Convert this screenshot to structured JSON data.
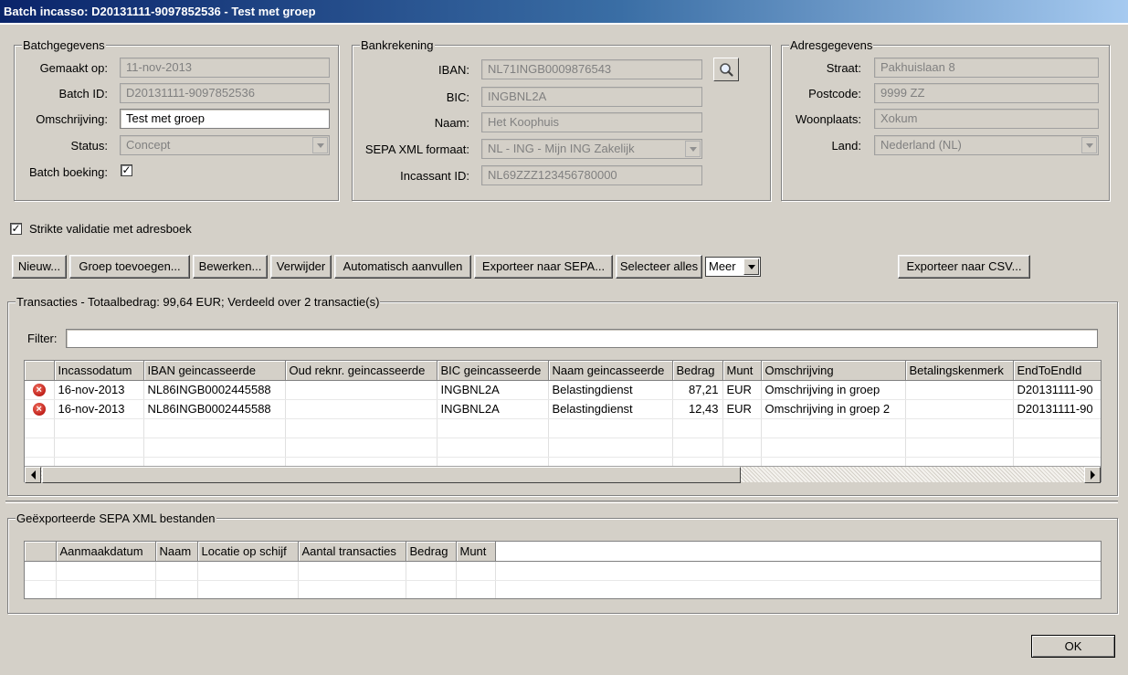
{
  "window": {
    "title": "Batch incasso: D20131111-9097852536 - Test met groep"
  },
  "batch": {
    "legend": "Batchgegevens",
    "created_label": "Gemaakt op:",
    "created_value": "11-nov-2013",
    "id_label": "Batch ID:",
    "id_value": "D20131111-9097852536",
    "desc_label": "Omschrijving:",
    "desc_value": "Test met groep",
    "status_label": "Status:",
    "status_value": "Concept",
    "booking_label": "Batch boeking:",
    "booking_checked": "✓"
  },
  "bank": {
    "legend": "Bankrekening",
    "iban_label": "IBAN:",
    "iban_value": "NL71INGB0009876543",
    "bic_label": "BIC:",
    "bic_value": "INGBNL2A",
    "name_label": "Naam:",
    "name_value": "Het Koophuis",
    "format_label": "SEPA XML formaat:",
    "format_value": "NL - ING - Mijn ING Zakelijk",
    "creditor_label": "Incassant ID:",
    "creditor_value": "NL69ZZZ123456780000"
  },
  "address": {
    "legend": "Adresgegevens",
    "street_label": "Straat:",
    "street_value": "Pakhuislaan 8",
    "zip_label": "Postcode:",
    "zip_value": "9999 ZZ",
    "city_label": "Woonplaats:",
    "city_value": "Xokum",
    "country_label": "Land:",
    "country_value": "Nederland (NL)"
  },
  "strict_validation": {
    "label": "Strikte validatie met adresboek",
    "checked": "✓"
  },
  "toolbar": {
    "new": "Nieuw...",
    "add_group": "Groep toevoegen...",
    "edit": "Bewerken...",
    "delete": "Verwijder",
    "autofill": "Automatisch aanvullen",
    "export_sepa": "Exporteer naar SEPA...",
    "select_all": "Selecteer alles",
    "more": "Meer",
    "export_csv": "Exporteer naar CSV..."
  },
  "transactions": {
    "legend": "Transacties - Totaalbedrag: 99,64 EUR; Verdeeld over 2 transactie(s)",
    "filter_label": "Filter:",
    "filter_value": "",
    "columns": [
      "",
      "Incassodatum",
      "IBAN geincasseerde",
      "Oud reknr. geincasseerde",
      "BIC geincasseerde",
      "Naam geincasseerde",
      "Bedrag",
      "Munt",
      "Omschrijving",
      "Betalingskenmerk",
      "EndToEndId"
    ],
    "rows": [
      [
        "16-nov-2013",
        "NL86INGB0002445588",
        "",
        "INGBNL2A",
        "Belastingdienst",
        "87,21",
        "EUR",
        "Omschrijving in groep",
        "",
        "D20131111-90"
      ],
      [
        "16-nov-2013",
        "NL86INGB0002445588",
        "",
        "INGBNL2A",
        "Belastingdienst",
        "12,43",
        "EUR",
        "Omschrijving in groep 2",
        "",
        "D20131111-90"
      ]
    ]
  },
  "exports": {
    "legend": "Geëxporteerde SEPA XML bestanden",
    "columns": [
      "",
      "Aanmaakdatum",
      "Naam",
      "Locatie op schijf",
      "Aantal transacties",
      "Bedrag",
      "Munt",
      ""
    ]
  },
  "footer": {
    "ok": "OK"
  },
  "colors": {
    "title_start": "#0a246a",
    "title_end": "#a6caf0",
    "error_red": "#c0201a",
    "face": "#d4d0c8"
  }
}
